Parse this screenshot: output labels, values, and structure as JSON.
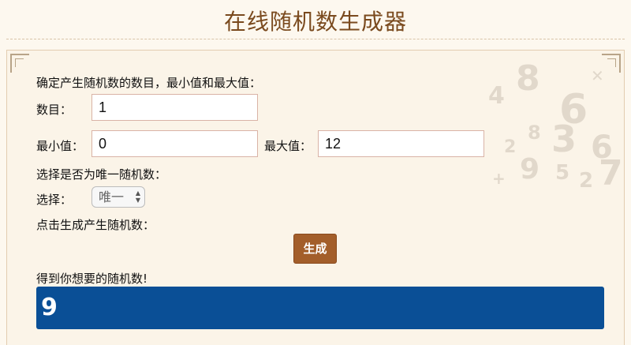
{
  "page": {
    "title": "在线随机数生成器"
  },
  "form": {
    "intro": "确定产生随机数的数目，最小值和最大值：",
    "count_label": "数目：",
    "count_value": "1",
    "min_label": "最小值：",
    "min_value": "0",
    "max_label": "最大值：",
    "max_value": "12",
    "unique_prompt": "选择是否为唯一随机数：",
    "select_label": "选择：",
    "select_value": "唯一",
    "generate_prompt": "点击生成产生随机数：",
    "generate_button": "生成",
    "result_prompt": "得到你想要的随机数!",
    "result_value": "9"
  },
  "colors": {
    "title": "#7a4a1e",
    "button": "#a35e2a",
    "result_bg": "#0a4f96"
  }
}
